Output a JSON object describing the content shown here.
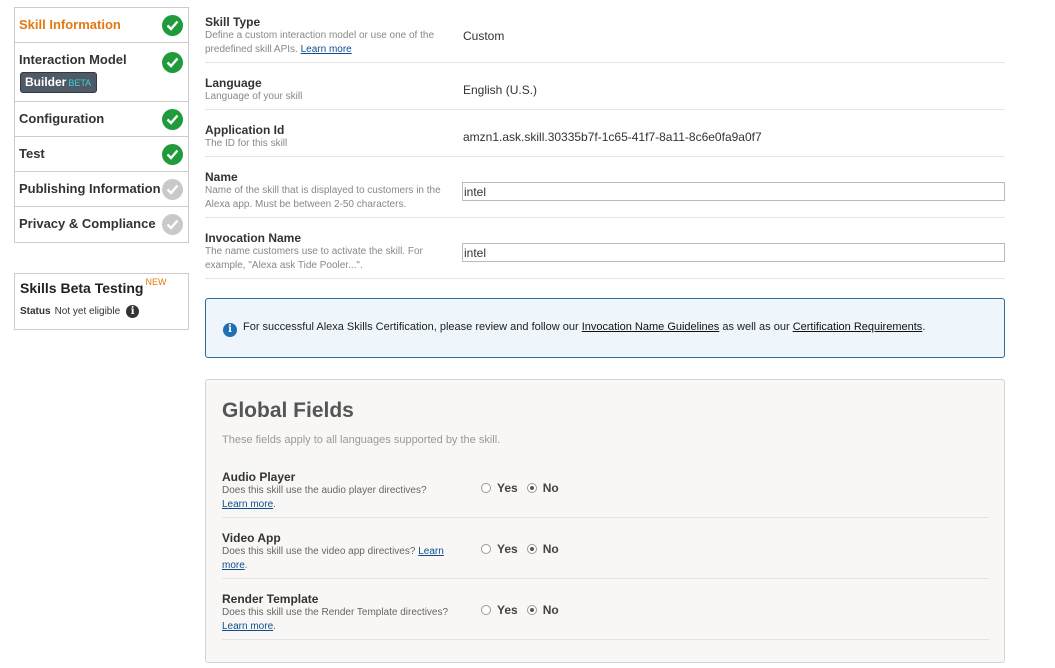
{
  "sidebar": {
    "items": [
      {
        "label": "Skill Information",
        "status": "complete"
      },
      {
        "label": "Interaction Model",
        "status": "complete",
        "badge": "Builder",
        "badge_tag": "BETA"
      },
      {
        "label": "Configuration",
        "status": "complete"
      },
      {
        "label": "Test",
        "status": "complete"
      },
      {
        "label": "Publishing Information",
        "status": "incomplete"
      },
      {
        "label": "Privacy & Compliance",
        "status": "incomplete"
      }
    ],
    "beta_testing": {
      "title": "Skills Beta Testing",
      "tag": "NEW",
      "status_label": "Status",
      "status_value": "Not yet eligible"
    }
  },
  "fields": {
    "skill_type": {
      "label": "Skill Type",
      "desc": "Define a custom interaction model or use one of the predefined skill APIs.",
      "link": "Learn more",
      "value": "Custom"
    },
    "language": {
      "label": "Language",
      "desc": "Language of your skill",
      "value": "English (U.S.)"
    },
    "application_id": {
      "label": "Application Id",
      "desc": "The ID for this skill",
      "value": "amzn1.ask.skill.30335b7f-1c65-41f7-8a11-8c6e0fa9a0f7"
    },
    "name": {
      "label": "Name",
      "desc": "Name of the skill that is displayed to customers in the Alexa app. Must be between 2-50 characters.",
      "value": "intel"
    },
    "invocation_name": {
      "label": "Invocation Name",
      "desc": "The name customers use to activate the skill. For example, \"Alexa ask Tide Pooler...\".",
      "value": "intel"
    }
  },
  "notice": {
    "text_before": "For successful Alexa Skills Certification, please review and follow our",
    "link1": "Invocation Name Guidelines",
    "text_mid": "as well as our",
    "link2": "Certification Requirements",
    "text_after": "."
  },
  "global_fields": {
    "title": "Global Fields",
    "subtitle": "These fields apply to all languages supported by the skill.",
    "yes_label": "Yes",
    "no_label": "No",
    "learn_more": "Learn more",
    "video_learn_1": "Learn",
    "video_learn_2": "more",
    "items": [
      {
        "label": "Audio Player",
        "desc": "Does this skill use the audio player directives?",
        "selected": "No"
      },
      {
        "label": "Video App",
        "desc": "Does this skill use the video app directives?",
        "selected": "No"
      },
      {
        "label": "Render Template",
        "desc": "Does this skill use the Render Template directives?",
        "selected": "No"
      }
    ]
  },
  "colors": {
    "accent": "#e47911",
    "check_green": "#1f9b3c",
    "check_grey": "#c9c9c9",
    "link": "#0b4e8f",
    "notice_border": "#2b6aa0"
  }
}
